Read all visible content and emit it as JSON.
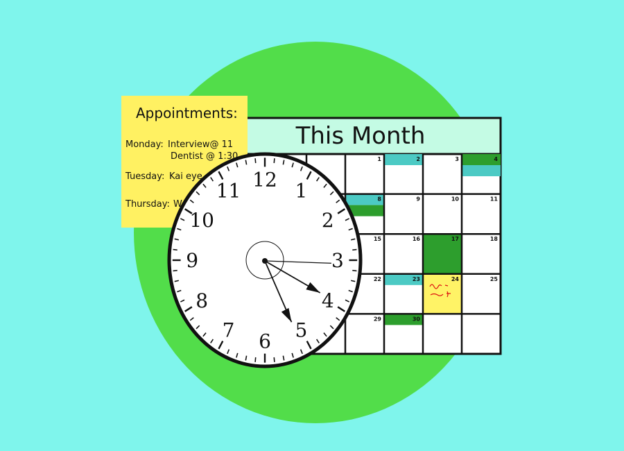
{
  "colors": {
    "background": "#7ff5ec",
    "circle": "#52dd4a",
    "header": "#c4fbe4",
    "note": "#fff162",
    "teal": "#4ccac4",
    "green": "#2d9e2d",
    "yellow_cell": "#fff366",
    "ink": "#111111",
    "red_ink": "#dd1111"
  },
  "calendar": {
    "title": "This Month",
    "rows": [
      [
        "",
        "",
        "1",
        "2",
        "3",
        "4"
      ],
      [
        "",
        "",
        "8",
        "9",
        "10",
        "11"
      ],
      [
        "",
        "",
        "15",
        "16",
        "17",
        "18"
      ],
      [
        "",
        "",
        "22",
        "23",
        "24",
        "25"
      ],
      [
        "",
        "",
        "29",
        "30",
        "",
        ""
      ]
    ],
    "markers": [
      {
        "day": "2",
        "color": "teal",
        "part": "top"
      },
      {
        "day": "4",
        "color": "green",
        "part": "top"
      },
      {
        "day": "4",
        "color": "teal",
        "part": "bottom"
      },
      {
        "day": "8",
        "color": "teal",
        "part": "top"
      },
      {
        "day": "8",
        "color": "green",
        "part": "bottom"
      },
      {
        "day": "17",
        "color": "green",
        "part": "full"
      },
      {
        "day": "23",
        "color": "teal",
        "part": "top"
      },
      {
        "day": "24",
        "color": "yellow_cell",
        "part": "full"
      },
      {
        "day": "30",
        "color": "green",
        "part": "top"
      }
    ]
  },
  "note": {
    "title": "Appointments:",
    "lines": [
      {
        "day": "Monday:",
        "text": "Interview@ 11"
      },
      {
        "day": "",
        "text": "Dentist @ 1:30"
      },
      {
        "day": "Tuesday:",
        "text": "Kai eye"
      },
      {
        "day": "Thursday:",
        "text": "W"
      }
    ]
  },
  "clock": {
    "numerals": [
      "12",
      "1",
      "2",
      "3",
      "4",
      "5",
      "6",
      "7",
      "8",
      "9",
      "10",
      "11"
    ],
    "hands": {
      "hour_deg": 120,
      "minute_deg": 152,
      "second_deg": 92
    }
  },
  "icons": {
    "clock": "clock-icon",
    "calendar": "calendar-icon",
    "note": "sticky-note-icon"
  }
}
